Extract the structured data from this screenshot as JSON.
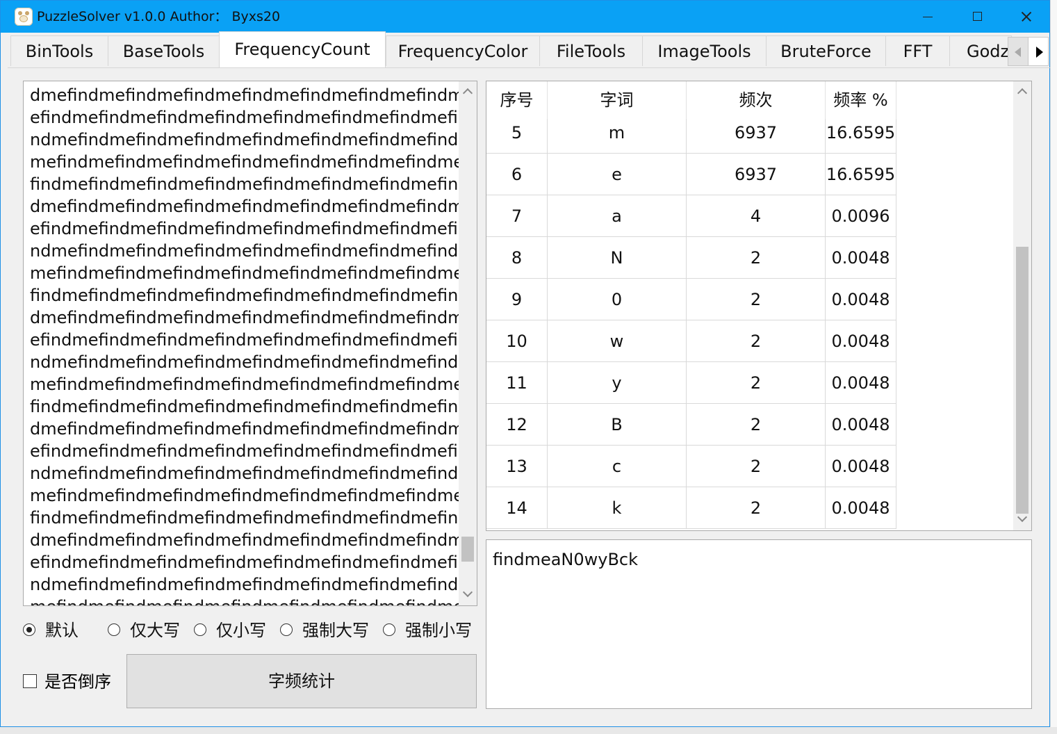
{
  "window": {
    "title": "PuzzleSolver v1.0.0  Author： Byxs20"
  },
  "tabs": [
    {
      "label": "BinTools",
      "active": false
    },
    {
      "label": "BaseTools",
      "active": false
    },
    {
      "label": "FrequencyCount",
      "active": true
    },
    {
      "label": "FrequencyColor",
      "active": false
    },
    {
      "label": "FileTools",
      "active": false
    },
    {
      "label": "ImageTools",
      "active": false
    },
    {
      "label": "BruteForce",
      "active": false
    },
    {
      "label": "FFT",
      "active": false
    },
    {
      "label": "Godzi",
      "active": false
    }
  ],
  "input_text": {
    "lines": [
      "dmefindmefindmefindmefindmefindmefindmefindm",
      "efindmefindmefindmefindmefindmefindmefindmefi",
      "ndmefindmefindmefindmefindmefindmefindmefind",
      "mefindmefindmefindmefindmefindmefindmefindme",
      "findmefindmefindmefindmefindmefindmefindmefin",
      "dmefindmefindmefindmefindmefindmefindmefindm",
      "efindmefindmefindmefindmefindmefindmefindmefi",
      "ndmefindmefindmefindmefindmefindmefindmefind",
      "mefindmefindmefindmefindmefindmefindmefindme",
      "findmefindmefindmefindmefindmefindmefindmefin",
      "dmefindmefindmefindmefindmefindmefindmefindm",
      "efindmefindmefindmefindmefindmefindmefindmefi",
      "ndmefindmefindmefindmefindmefindmefindmefind",
      "mefindmefindmefindmefindmefindmefindmefindme",
      "findmefindmefindmefindmefindmefindmefindmefin",
      "dmefindmefindmefindmefindmefindmefindmefindm",
      "efindmefindmefindmefindmefindmefindmefindmefi",
      "ndmefindmefindmefindmefindmefindmefindmefind",
      "mefindmefindmefindmefindmefindmefindmefindme",
      "findmefindmefindmefindmefindmefindmefindmefin",
      "dmefindmefindmefindmefindmefindmefindmefindm",
      "efindmefindmefindmefindmefindmefindmefindmefi",
      "ndmefindmefindmefindmefindmefindmefindmefind",
      "mefindmefindmefindmefindmefindmefindmefindme"
    ]
  },
  "options": {
    "radios": [
      {
        "label": "默认",
        "checked": true
      },
      {
        "label": "仅大写",
        "checked": false
      },
      {
        "label": "仅小写",
        "checked": false
      },
      {
        "label": "强制大写",
        "checked": false
      },
      {
        "label": "强制小写",
        "checked": false
      }
    ],
    "reverse_label": "是否倒序",
    "reverse_checked": false,
    "count_button": "字频统计"
  },
  "table": {
    "columns": [
      "序号",
      "字词",
      "频次",
      "频率 %"
    ],
    "rows": [
      [
        "5",
        "m",
        "6937",
        "16.6595"
      ],
      [
        "6",
        "e",
        "6937",
        "16.6595"
      ],
      [
        "7",
        "a",
        "4",
        "0.0096"
      ],
      [
        "8",
        "N",
        "2",
        "0.0048"
      ],
      [
        "9",
        "0",
        "2",
        "0.0048"
      ],
      [
        "10",
        "w",
        "2",
        "0.0048"
      ],
      [
        "11",
        "y",
        "2",
        "0.0048"
      ],
      [
        "12",
        "B",
        "2",
        "0.0048"
      ],
      [
        "13",
        "c",
        "2",
        "0.0048"
      ],
      [
        "14",
        "k",
        "2",
        "0.0048"
      ]
    ]
  },
  "result": {
    "text": "findmeaN0wyBck"
  },
  "icons": {
    "app": "sheep-app-icon",
    "minimize": "minimize-icon",
    "maximize": "maximize-icon",
    "close": "close-icon",
    "tab_left": "chevron-left-icon",
    "tab_right": "chevron-right-icon"
  },
  "colors": {
    "titlebar": "#0aa1f5",
    "scroll_thumb": "#c2c2c2"
  }
}
